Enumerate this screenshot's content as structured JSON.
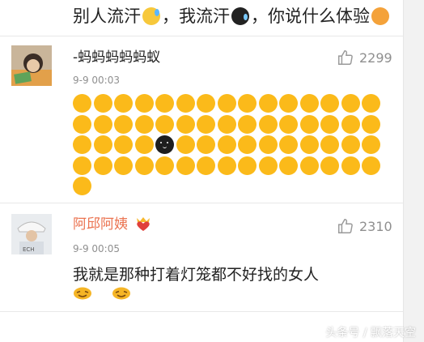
{
  "top_comment": {
    "segments": [
      "别人流汗",
      "，我流汗",
      "，你说什么体验"
    ],
    "emoji_icons": [
      "sweat-emoji",
      "dark-sweat-emoji",
      "angry-emoji"
    ]
  },
  "comments": [
    {
      "username": "-蚂蚂蚂蚂蚂蚁",
      "time": "9-9 00:03",
      "likes": "2299",
      "avatar_icon": "user-avatar",
      "dot_rows": [
        15,
        15,
        15,
        15,
        1
      ],
      "special_dot": {
        "row": 2,
        "col": 4,
        "icon": "black-face-emoji"
      }
    },
    {
      "username": "阿邱阿姨",
      "badge_icon": "heart-crown-badge-icon",
      "time": "9-9 00:05",
      "likes": "2310",
      "avatar_icon": "user-avatar",
      "text": "我就是那种打着灯笼都不好找的女人",
      "emoji_icons": [
        "laughing-emoji",
        "laughing-emoji"
      ]
    }
  ],
  "footer": {
    "watermark_text": "头条号 / 飘落天空"
  },
  "colors": {
    "dot": "#fbba1a",
    "username_orange": "#eb7350",
    "meta_gray": "#8f8f8f"
  }
}
